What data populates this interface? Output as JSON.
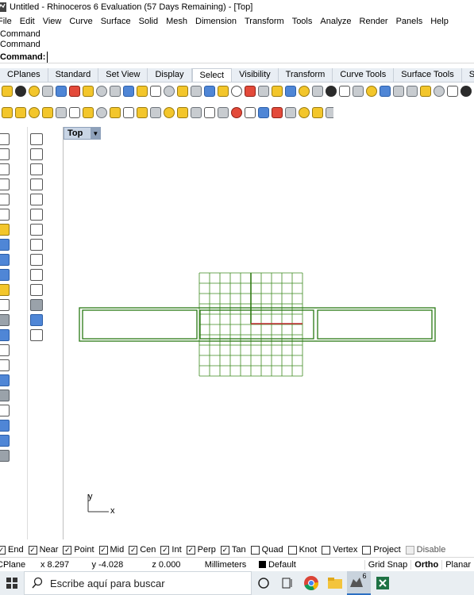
{
  "window": {
    "title": "Untitled - Rhinoceros 6 Evaluation (57 Days Remaining) - [Top]"
  },
  "menu": [
    "File",
    "Edit",
    "View",
    "Curve",
    "Surface",
    "Solid",
    "Mesh",
    "Dimension",
    "Transform",
    "Tools",
    "Analyze",
    "Render",
    "Panels",
    "Help"
  ],
  "command": {
    "history": [
      "Command",
      "Command"
    ],
    "prompt_label": "Command:",
    "value": ""
  },
  "tabs": [
    "CPlanes",
    "Standard",
    "Set View",
    "Display",
    "Select",
    "Visibility",
    "Transform",
    "Curve Tools",
    "Surface Tools",
    "Solid Tools"
  ],
  "active_tab": "Select",
  "viewport": {
    "name": "Top",
    "axis_y_label": "y",
    "axis_x_label": "x"
  },
  "osnaps": [
    {
      "label": "End",
      "checked": true
    },
    {
      "label": "Near",
      "checked": true
    },
    {
      "label": "Point",
      "checked": true
    },
    {
      "label": "Mid",
      "checked": true
    },
    {
      "label": "Cen",
      "checked": true
    },
    {
      "label": "Int",
      "checked": true
    },
    {
      "label": "Perp",
      "checked": true
    },
    {
      "label": "Tan",
      "checked": true
    },
    {
      "label": "Quad",
      "checked": false
    },
    {
      "label": "Knot",
      "checked": false
    },
    {
      "label": "Vertex",
      "checked": false
    },
    {
      "label": "Project",
      "checked": false
    },
    {
      "label": "Disable",
      "checked": false,
      "dim": true
    }
  ],
  "status": {
    "cplane": "CPlane",
    "x": "x 8.297",
    "y": "y -4.028",
    "z": "z 0.000",
    "units": "Millimeters",
    "layer": "Default",
    "grid_snap": "Grid Snap",
    "ortho": "Ortho",
    "planar": "Planar"
  },
  "taskbar": {
    "search_placeholder": "Escribe aquí para buscar",
    "rhino_badge": "6"
  },
  "colors": {
    "grid_line": "#3d8a1f",
    "x_axis": "#c0272d",
    "y_axis": "#2f7a12",
    "rect_line": "#2a7a14",
    "tab_bg": "#e9eef4",
    "viewport_tab": "#c9d5e5"
  }
}
